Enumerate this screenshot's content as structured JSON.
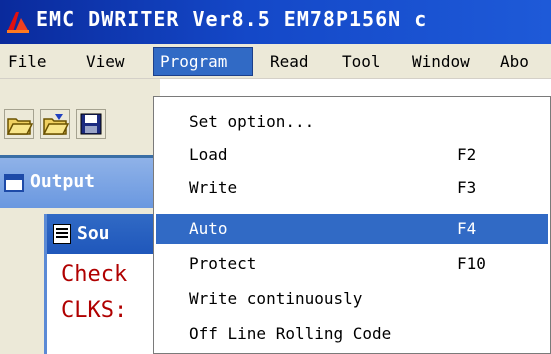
{
  "window": {
    "title": "EMC DWRITER Ver8.5  EM78P156N c"
  },
  "menubar": {
    "items": [
      {
        "label": "File"
      },
      {
        "label": "View"
      },
      {
        "label": "Program"
      },
      {
        "label": "Read"
      },
      {
        "label": "Tool"
      },
      {
        "label": "Window"
      },
      {
        "label": "Abo"
      }
    ]
  },
  "toolbar": {
    "buttons": [
      "open-folder-icon",
      "edit-folder-icon",
      "save-icon"
    ]
  },
  "background": {
    "output_title": "Output",
    "source_title": "Sou",
    "source_lines": [
      "Check",
      "CLKS:"
    ]
  },
  "program_menu": {
    "items": [
      {
        "label": "Set option...",
        "shortcut": ""
      },
      {
        "label": "Load",
        "shortcut": "F2"
      },
      {
        "label": "Write",
        "shortcut": "F3"
      },
      {
        "label": "Auto",
        "shortcut": "F4"
      },
      {
        "label": "Protect",
        "shortcut": "F10"
      },
      {
        "label": "Write continuously",
        "shortcut": ""
      },
      {
        "label": "Off Line Rolling Code",
        "shortcut": ""
      }
    ],
    "highlighted_index": 3
  },
  "colors": {
    "titlebar": "#0a2a9c",
    "highlight": "#316ac5",
    "menubar_bg": "#ece9d8",
    "source_text": "#b00000"
  }
}
